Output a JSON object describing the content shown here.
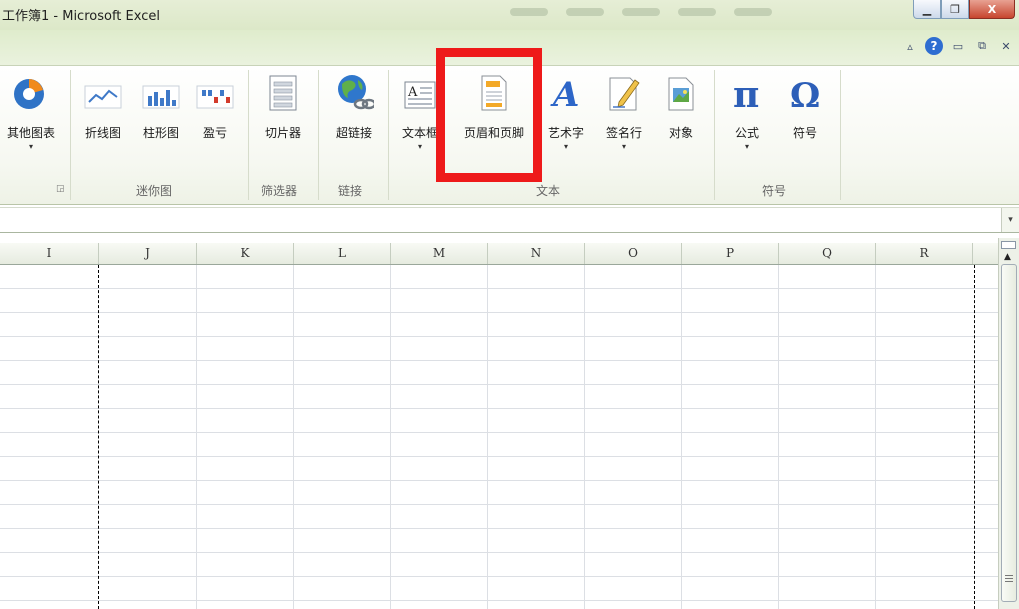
{
  "window": {
    "title": "工作簿1  -  Microsoft Excel",
    "minimize_glyph": "▁",
    "restore_glyph": "❐",
    "close_glyph": "X"
  },
  "ribbon_controls": {
    "collapse_glyph": "▵",
    "help_glyph": "?",
    "minimize_glyph": "▭",
    "restore_glyph": "⧉",
    "close_glyph": "✕"
  },
  "ribbon": {
    "buttons": {
      "other_charts": "其他图表",
      "line": "折线图",
      "column": "柱形图",
      "winloss": "盈亏",
      "slicer": "切片器",
      "hyperlink": "超链接",
      "textbox": "文本框",
      "header_footer": "页眉和页脚",
      "wordart": "艺术字",
      "signature": "签名行",
      "object": "对象",
      "equation": "公式",
      "symbol": "符号"
    },
    "groups": {
      "sparklines": "迷你图",
      "filter": "筛选器",
      "links": "链接",
      "text": "文本",
      "symbols": "符号"
    },
    "dropdown_glyph": "▾",
    "launcher_glyph": "◲"
  },
  "formula_bar": {
    "expand_glyph": "▾"
  },
  "grid": {
    "columns": [
      "I",
      "J",
      "K",
      "L",
      "M",
      "N",
      "O",
      "P",
      "Q",
      "R"
    ]
  },
  "scrollbar": {
    "up_glyph": "▲"
  },
  "colors": {
    "highlight": "#ee1a1a",
    "ribbon_bg": "#f6f8f1",
    "title_bg": "#dce8c8"
  }
}
